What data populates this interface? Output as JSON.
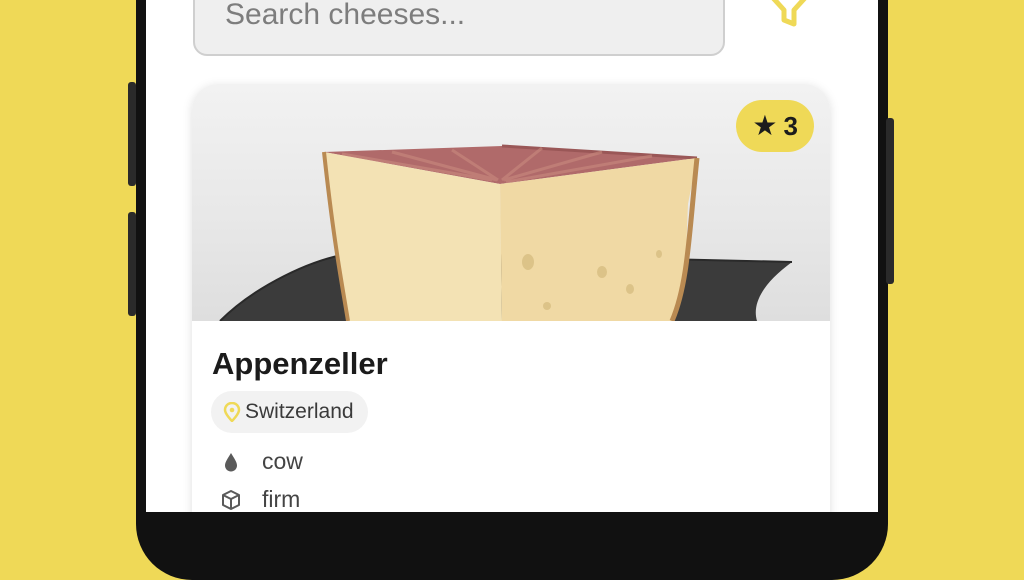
{
  "search": {
    "placeholder": "Search cheeses..."
  },
  "icons": {
    "filter": "funnel-icon",
    "star": "star-icon",
    "location": "map-pin-icon",
    "milk": "droplet-icon",
    "texture": "cube-icon"
  },
  "colors": {
    "background": "#EFD957",
    "accent": "#EFD957",
    "text": "#1b1b1b"
  },
  "card": {
    "rating_star": "★",
    "rating": "3",
    "name": "Appenzeller",
    "origin": "Switzerland",
    "milk": "cow",
    "texture": "firm"
  }
}
